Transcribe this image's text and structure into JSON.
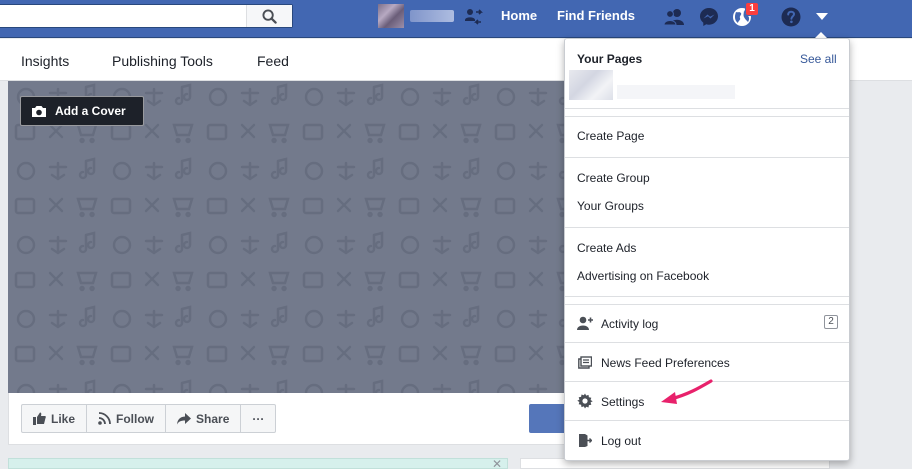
{
  "topbar": {
    "search_placeholder": "",
    "nav": {
      "home": "Home",
      "find_friends": "Find Friends"
    },
    "notifications_count": "1"
  },
  "page_tabs": [
    "Insights",
    "Publishing Tools",
    "Feed"
  ],
  "cover": {
    "add_cover_label": "Add a Cover"
  },
  "actions": {
    "like": "Like",
    "follow": "Follow",
    "share": "Share",
    "more": "···"
  },
  "menu": {
    "your_pages_heading": "Your Pages",
    "see_all": "See all",
    "create_page": "Create Page",
    "create_group": "Create Group",
    "your_groups": "Your Groups",
    "create_ads": "Create Ads",
    "advertising": "Advertising on Facebook",
    "activity_log": "Activity log",
    "activity_log_count": "2",
    "news_feed_prefs": "News Feed Preferences",
    "settings": "Settings",
    "log_out": "Log out"
  },
  "colors": {
    "brand_blue": "#4267b2",
    "annotation_arrow": "#e8216b"
  }
}
